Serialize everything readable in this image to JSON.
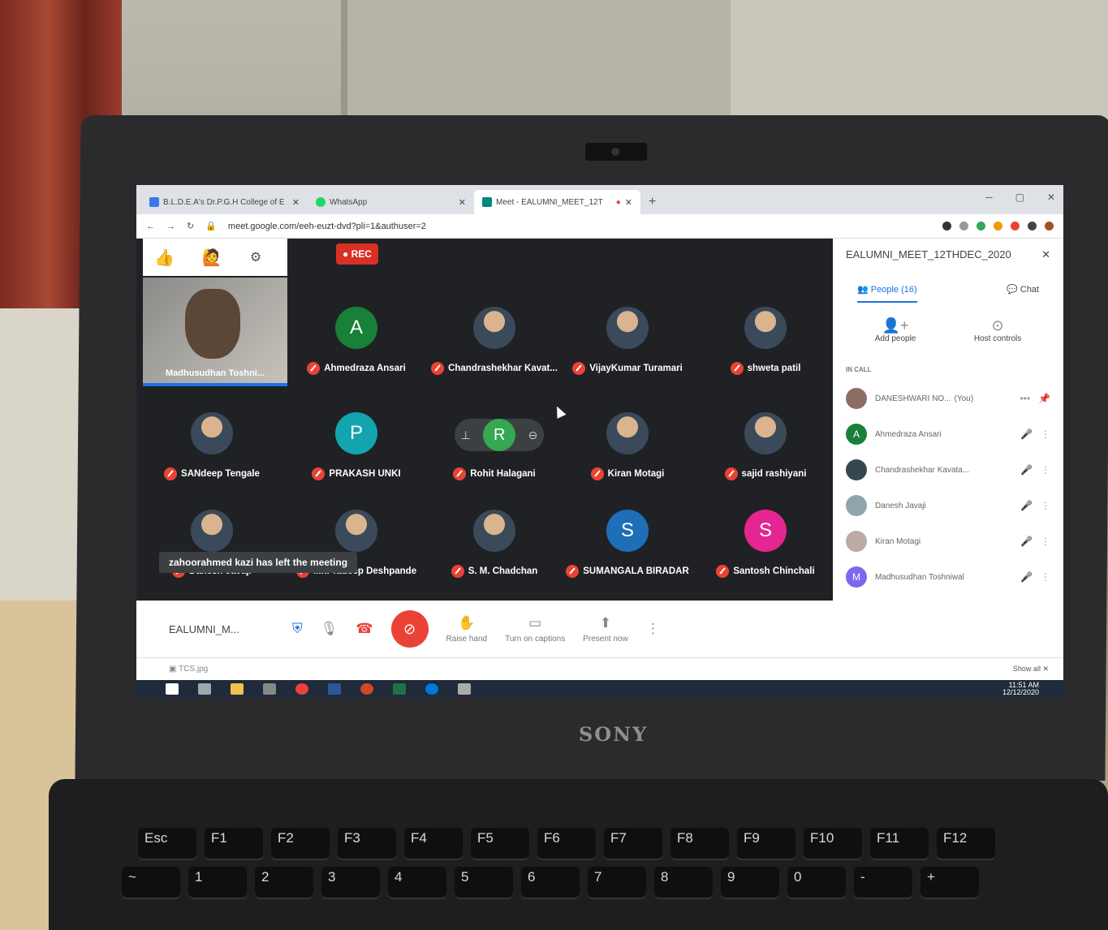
{
  "browser": {
    "tabs": [
      {
        "label": "B.L.D.E.A's Dr.P.G.H College of E",
        "favicon_color": "#3b78e7"
      },
      {
        "label": "WhatsApp",
        "favicon_color": "#25d366"
      },
      {
        "label": "Meet - EALUMNI_MEET_12T",
        "favicon_color": "#00897b"
      }
    ],
    "url": "meet.google.com/eeh-euzt-dvd?pli=1&authuser=2"
  },
  "meet": {
    "rec_label": "REC",
    "self_name": "Madhusudhan Toshni...",
    "participants": [
      {
        "name": "Ahmedraza Ansari",
        "initial": "A",
        "color": "#188038"
      },
      {
        "name": "Chandrashekhar Kavat...",
        "initial": "",
        "color": "photo"
      },
      {
        "name": "VijayKumar Turamari",
        "initial": "",
        "color": "photo"
      },
      {
        "name": "shweta patil",
        "initial": "",
        "color": "photo"
      },
      {
        "name": "SANdeep Tengale",
        "initial": "",
        "color": "photo"
      },
      {
        "name": "PRAKASH UNKI",
        "initial": "P",
        "color": "#12a4af"
      },
      {
        "name": "Rohit Halagani",
        "initial": "R",
        "color": "#34a853"
      },
      {
        "name": "Kiran Motagi",
        "initial": "",
        "color": "photo"
      },
      {
        "name": "sajid rashiyani",
        "initial": "",
        "color": "photo"
      },
      {
        "name": "Danesh Javaji",
        "initial": "",
        "color": "photo"
      },
      {
        "name": "Mr.Pradeep Deshpande",
        "initial": "",
        "color": "photo"
      },
      {
        "name": "S. M. Chadchan",
        "initial": "",
        "color": "photo"
      },
      {
        "name": "SUMANGALA BIRADAR",
        "initial": "S",
        "color": "#1e6fb8"
      },
      {
        "name": "Santosh Chinchali",
        "initial": "S",
        "color": "#e52592"
      }
    ],
    "toast": "zahoorahmed kazi has left the meeting",
    "bottom": {
      "meeting_name": "EALUMNI_M...",
      "raise_hand": "Raise hand",
      "captions": "Turn on captions",
      "present": "Present now"
    }
  },
  "panel": {
    "title": "EALUMNI_MEET_12THDEC_2020",
    "people_tab": "People (16)",
    "chat_tab": "Chat",
    "add_people": "Add people",
    "host_controls": "Host controls",
    "in_call": "IN CALL",
    "people": [
      {
        "name": "DANESHWARI NO...",
        "suffix": "(You)",
        "initial": "",
        "color": "#8d6e63"
      },
      {
        "name": "Ahmedraza Ansari",
        "suffix": "",
        "initial": "A",
        "color": "#188038"
      },
      {
        "name": "Chandrashekhar Kavata...",
        "suffix": "",
        "initial": "",
        "color": "#37474f"
      },
      {
        "name": "Danesh Javaji",
        "suffix": "",
        "initial": "",
        "color": "#90a4ae"
      },
      {
        "name": "Kiran Motagi",
        "suffix": "",
        "initial": "",
        "color": "#bcaaa4"
      },
      {
        "name": "Madhusudhan Toshniwal",
        "suffix": "",
        "initial": "M",
        "color": "#7b68ee"
      }
    ]
  },
  "download": {
    "file": "TCS.jpg",
    "show_all": "Show all"
  },
  "taskbar": {
    "time": "11:51 AM",
    "date": "12/12/2020"
  },
  "laptop": {
    "brand": "SONY"
  }
}
